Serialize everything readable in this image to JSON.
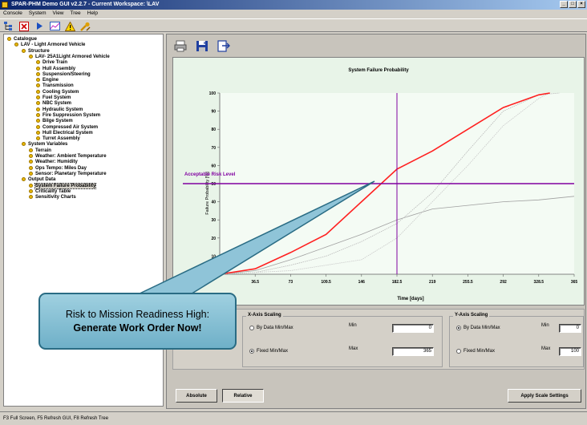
{
  "window": {
    "title": "SPAR-PHM Demo GUI v2.2.7 - Current Workspace: \\LAV",
    "controls": [
      "_",
      "□",
      "×"
    ]
  },
  "menu": [
    "Console",
    "System",
    "View",
    "Tree",
    "Help"
  ],
  "toolbar": {
    "icons": [
      "tree-toggle-icon",
      "stop-icon",
      "play-icon",
      "chart-icon",
      "warning-icon",
      "tools-icon"
    ]
  },
  "tree": {
    "items": [
      {
        "label": "Catalogue",
        "level": 0
      },
      {
        "label": "LAV - Light Armored Vehicle",
        "level": 1
      },
      {
        "label": "Structure",
        "level": 2
      },
      {
        "label": "LAV- 25A1Light Armored Vehicle",
        "level": 3
      },
      {
        "label": "Drive Train",
        "level": 4
      },
      {
        "label": "Hull Assembly",
        "level": 4
      },
      {
        "label": "Suspension/Steering",
        "level": 4
      },
      {
        "label": "Engine",
        "level": 4
      },
      {
        "label": "Transmission",
        "level": 4
      },
      {
        "label": "Cooling System",
        "level": 4
      },
      {
        "label": "Fuel System",
        "level": 4
      },
      {
        "label": "NBC System",
        "level": 4
      },
      {
        "label": "Hydraulic System",
        "level": 4
      },
      {
        "label": "Fire Suppression System",
        "level": 4
      },
      {
        "label": "Bilge System",
        "level": 4
      },
      {
        "label": "Compressed Air System",
        "level": 4
      },
      {
        "label": "Hull Electrical System",
        "level": 4
      },
      {
        "label": "Turret Assembly",
        "level": 4
      },
      {
        "label": "System Variables",
        "level": 2
      },
      {
        "label": "Terrain",
        "level": 3
      },
      {
        "label": "Weather: Ambient Temperature",
        "level": 3
      },
      {
        "label": "Weather: Humidity",
        "level": 3
      },
      {
        "label": "Ops Tempo: Miles Day",
        "level": 3
      },
      {
        "label": "Sensor: Planetary Temperature",
        "level": 3
      },
      {
        "label": "Output Data",
        "level": 2
      },
      {
        "label": "System Failure Probability",
        "level": 3,
        "selected": true
      },
      {
        "label": "Criticality Table",
        "level": 3
      },
      {
        "label": "Sensitivity Charts",
        "level": 3
      }
    ]
  },
  "main_toolbar": {
    "icons": [
      "print-icon",
      "save-icon",
      "export-icon"
    ]
  },
  "chart_data": {
    "type": "line",
    "title": "System Failure Probability",
    "xlabel": "Time [days]",
    "ylabel": "Failure Probability [%]",
    "xlim": [
      0,
      365
    ],
    "ylim": [
      0,
      100
    ],
    "x_ticks": [
      "36.5",
      "73",
      "109.5",
      "146",
      "182.5",
      "219",
      "255.5",
      "292",
      "328.5",
      "365"
    ],
    "y_ticks": [
      "10",
      "20",
      "30",
      "40",
      "50",
      "60",
      "70",
      "80",
      "90",
      "100"
    ],
    "risk_line": {
      "label": "Acceptable Risk Level",
      "y": 50,
      "color": "#8000a0"
    },
    "marker_line": {
      "x": 182.5,
      "color": "#8000a0"
    },
    "grid": false,
    "series": [
      {
        "color": "#ff2020",
        "x": [
          0,
          36.5,
          73,
          109.5,
          146,
          182.5,
          219,
          255.5,
          292,
          328.5,
          340
        ],
        "y": [
          0,
          3,
          12,
          22,
          40,
          58,
          68,
          80,
          92,
          99,
          100
        ]
      },
      {
        "color": "#a0a0a0",
        "x": [
          0,
          36.5,
          73,
          109.5,
          146,
          182.5,
          219,
          255.5,
          292,
          328.5,
          365
        ],
        "y": [
          0,
          2,
          8,
          15,
          22,
          30,
          36,
          38,
          40,
          41,
          43
        ]
      },
      {
        "color": "#b8b8b8",
        "x": [
          0,
          36.5,
          73,
          109.5,
          146,
          182.5,
          219,
          255.5,
          292,
          328.5,
          350
        ],
        "y": [
          0,
          1,
          5,
          10,
          18,
          28,
          45,
          68,
          90,
          99,
          100
        ]
      },
      {
        "color": "#c8c8c8",
        "x": [
          0,
          73,
          146,
          182.5,
          219,
          255.5,
          292,
          328.5,
          340
        ],
        "y": [
          0,
          2,
          8,
          20,
          40,
          60,
          82,
          97,
          100
        ]
      }
    ]
  },
  "settings": {
    "x_axis": {
      "title": "X-Axis Scaling",
      "option_data": "By Data Min/Max",
      "option_fixed": "Fixed Min/Max",
      "min_label": "Min",
      "max_label": "Max",
      "min_value": "0",
      "max_value": "365",
      "selected": "fixed"
    },
    "y_axis": {
      "title": "Y-Axis Scaling",
      "option_data": "By Data Min/Max",
      "option_fixed": "Fixed Min/Max",
      "min_label": "Min",
      "max_label": "Max",
      "min_value": "0",
      "max_value": "100",
      "selected": "data"
    }
  },
  "buttons": {
    "absolute": "Absolute",
    "relative": "Relative",
    "apply": "Apply Scale Settings"
  },
  "status": "F3 Full Screen, F5 Refresh GUI, F8 Refresh Tree",
  "callout": {
    "line1": "Risk to Mission Readiness High:",
    "line2": "Generate Work Order Now!"
  }
}
